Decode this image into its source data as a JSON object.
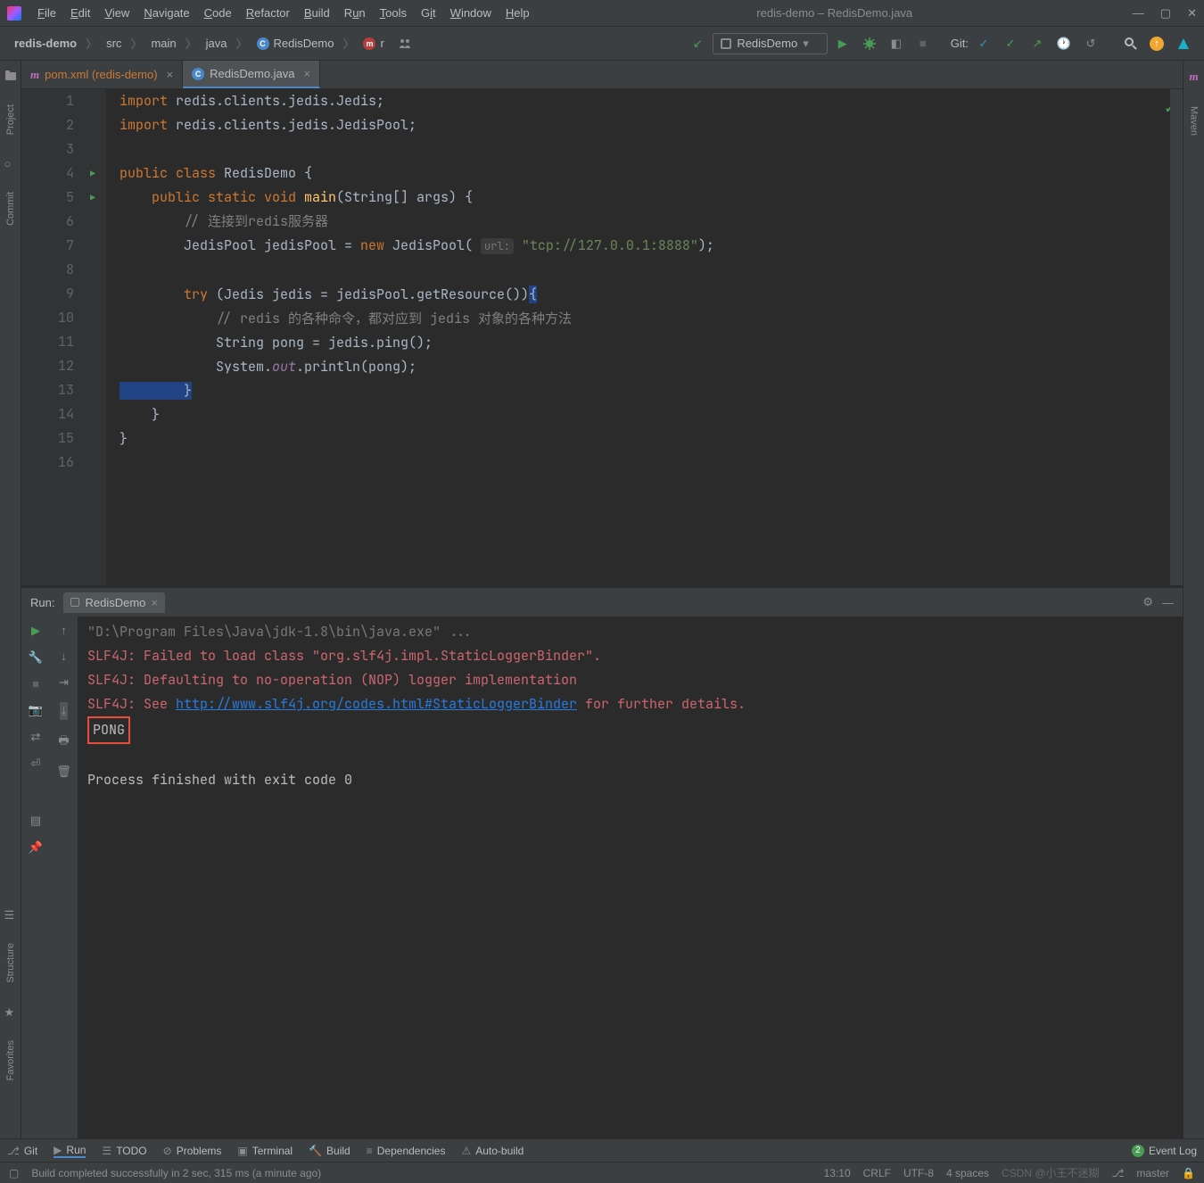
{
  "window": {
    "title": "redis-demo – RedisDemo.java"
  },
  "menus": [
    "File",
    "Edit",
    "View",
    "Navigate",
    "Code",
    "Refactor",
    "Build",
    "Run",
    "Tools",
    "Git",
    "Window",
    "Help"
  ],
  "breadcrumbs": {
    "parts": [
      "redis-demo",
      "src",
      "main",
      "java"
    ],
    "class_name": "RedisDemo",
    "method": "r"
  },
  "run_config": "RedisDemo",
  "vcs_label": "Git:",
  "tabs": [
    {
      "label": "pom.xml (redis-demo)",
      "kind": "maven",
      "active": false
    },
    {
      "label": "RedisDemo.java",
      "kind": "class",
      "active": true
    }
  ],
  "side_tools_left": [
    "Project",
    "Commit",
    "Structure",
    "Favorites"
  ],
  "side_tools_right": "Maven",
  "code": {
    "lines": [
      "1",
      "2",
      "3",
      "4",
      "5",
      "6",
      "7",
      "8",
      "9",
      "10",
      "11",
      "12",
      "13",
      "14",
      "15",
      "16"
    ],
    "l1a": "import ",
    "l1b": "redis.clients.jedis.Jedis",
    "l1c": ";",
    "l2a": "import ",
    "l2b": "redis.clients.jedis.JedisPool",
    "l2c": ";",
    "l4a": "public class ",
    "l4b": "RedisDemo ",
    "l4c": "{",
    "l5a": "    public static ",
    "l5b": "void ",
    "l5c": "main",
    "l5d": "(String[] args) {",
    "l6a": "        // 连接到redis服务器",
    "l7a": "        JedisPool jedisPool = ",
    "l7b": "new ",
    "l7c": "JedisPool( ",
    "l7h": "url:",
    "l7d": " \"tcp://127.0.0.1:8888\"",
    "l7e": ");",
    "l9a": "        try ",
    "l9b": "(Jedis jedis = jedisPool.getResource())",
    "l9c": "{",
    "l10a": "            // redis 的各种命令，都对应到 jedis 对象的各种方法",
    "l11a": "            String pong = jedis.ping();",
    "l12a": "            System.",
    "l12b": "out",
    "l12c": ".println(pong);",
    "l13a": "        }",
    "l14a": "    }",
    "l15a": "}"
  },
  "run_panel": {
    "title_prefix": "Run:",
    "tab_name": "RedisDemo",
    "lines": {
      "cmd": "\"D:\\Program Files\\Java\\jdk-1.8\\bin\\java.exe\" ...",
      "e1": "SLF4J: Failed to load class \"org.slf4j.impl.StaticLoggerBinder\".",
      "e2": "SLF4J: Defaulting to no-operation (NOP) logger implementation",
      "e3a": "SLF4J: See ",
      "e3l": "http://www.slf4j.org/codes.html#StaticLoggerBinder",
      "e3b": " for further details.",
      "out": "PONG",
      "done": "Process finished with exit code 0"
    }
  },
  "bottom_tools": {
    "git": "Git",
    "run": "Run",
    "todo": "TODO",
    "problems": "Problems",
    "terminal": "Terminal",
    "build": "Build",
    "deps": "Dependencies",
    "auto": "Auto-build",
    "event_count": "2",
    "event_log": "Event Log"
  },
  "status": {
    "msg": "Build completed successfully in 2 sec, 315 ms (a minute ago)",
    "pos": "13:10",
    "le": "CRLF",
    "enc": "UTF-8",
    "indent": "4 spaces",
    "branch": "master",
    "watermark": "CSDN @小王不迷糊"
  }
}
